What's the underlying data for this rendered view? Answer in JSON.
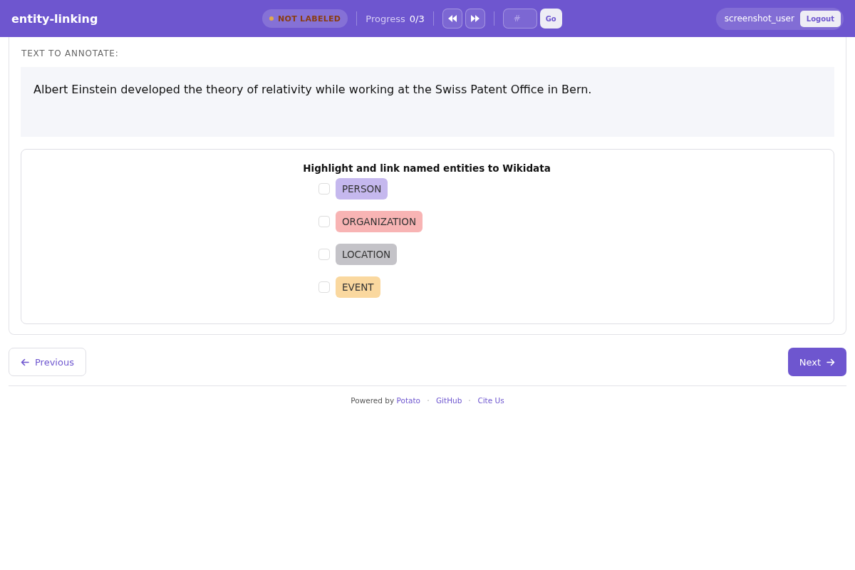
{
  "header": {
    "title": "entity-linking",
    "status": {
      "label": "NOT LABELED",
      "labeled": false
    },
    "progress_label": "Progress",
    "progress_value": "0/3",
    "jump": {
      "placeholder": "#",
      "button": "Go"
    },
    "user": "screenshot_user",
    "logout": "Logout"
  },
  "annotation": {
    "heading": "TEXT TO ANNOTATE:",
    "text": "Albert Einstein developed the theory of relativity while working at the Swiss Patent Office in Bern."
  },
  "task": {
    "title": "Highlight and link named entities to Wikidata",
    "labels": [
      {
        "label": "PERSON",
        "color": "#c5b8ee",
        "checked": false
      },
      {
        "label": "ORGANIZATION",
        "color": "#f8b4b4",
        "checked": false
      },
      {
        "label": "LOCATION",
        "color": "#c4c3c8",
        "checked": false
      },
      {
        "label": "EVENT",
        "color": "#fad89f",
        "checked": false
      }
    ]
  },
  "nav": {
    "previous": "Previous",
    "next": "Next"
  },
  "footer": {
    "powered": "Powered by ",
    "potato": "Potato",
    "links": [
      "GitHub",
      "Cite Us"
    ]
  }
}
